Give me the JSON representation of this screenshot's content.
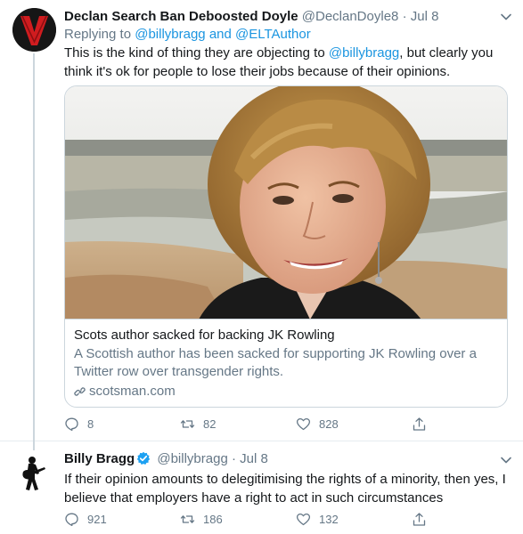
{
  "reply": {
    "name": "Declan Search Ban Deboosted Doyle",
    "handle": "@DeclanDoyle8",
    "separator": "·",
    "time": "Jul 8",
    "replying_prefix": "Replying to ",
    "replying_user1": "@billybragg",
    "replying_and": " and ",
    "replying_user2": "@ELTAuthor",
    "text_before": "This is the kind of thing they are objecting to ",
    "text_mention": "@billybragg",
    "text_after": ", but clearly you think it's ok for people to lose their jobs because of their opinions.",
    "card": {
      "title": "Scots author sacked for backing JK Rowling",
      "description": "A Scottish author has been sacked for supporting JK Rowling over a Twitter row over transgender rights.",
      "domain": "scotsman.com"
    },
    "actions": {
      "replies": "8",
      "retweets": "82",
      "likes": "828"
    }
  },
  "original": {
    "name": "Billy Bragg",
    "handle": "@billybragg",
    "separator": "·",
    "time": "Jul 8",
    "text": "If their opinion amounts to delegitimising the rights of a minority, then yes, I believe that employers have a right to act in such circumstances",
    "actions": {
      "replies": "921",
      "retweets": "186",
      "likes": "132"
    }
  },
  "icons": {
    "reply": "reply-icon",
    "retweet": "retweet-icon",
    "like": "heart-icon",
    "share": "share-icon",
    "caret": "chevron-down-icon",
    "verified": "verified-badge-icon",
    "link": "link-icon"
  },
  "colors": {
    "link": "#1b95e0",
    "secondary_text": "#657786",
    "primary_text": "#14171a",
    "border": "#ccd6dd",
    "verified": "#1da1f2",
    "avatar_red": "#d01c1f"
  }
}
